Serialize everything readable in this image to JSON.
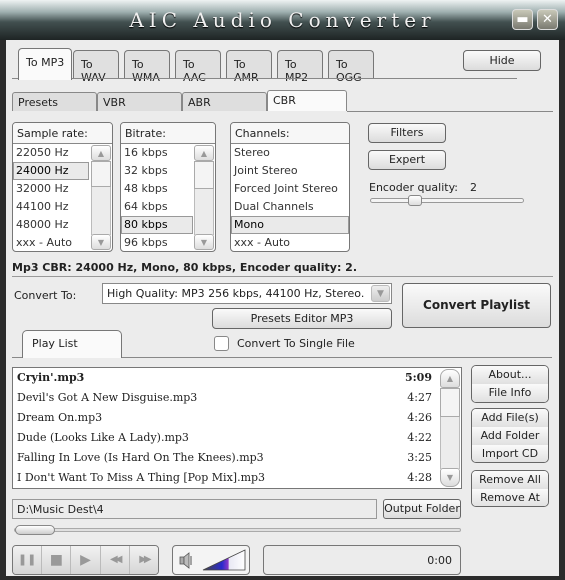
{
  "window": {
    "title": "AIC Audio Converter",
    "minimize_icon": "minimize-icon",
    "close_icon": "close-icon"
  },
  "format_tabs": [
    {
      "label": "To MP3",
      "active": true
    },
    {
      "label": "To WAV",
      "active": false
    },
    {
      "label": "To WMA",
      "active": false
    },
    {
      "label": "To AAC",
      "active": false
    },
    {
      "label": "To AMR",
      "active": false
    },
    {
      "label": "To MP2",
      "active": false
    },
    {
      "label": "To OGG",
      "active": false
    }
  ],
  "hide_label": "Hide",
  "mode_tabs": [
    {
      "label": "Presets",
      "active": false
    },
    {
      "label": "VBR",
      "active": false
    },
    {
      "label": "ABR",
      "active": false
    },
    {
      "label": "CBR",
      "active": true
    }
  ],
  "sample_rate": {
    "header": "Sample rate:",
    "items": [
      "22050 Hz",
      "24000 Hz",
      "32000 Hz",
      "44100 Hz",
      "48000 Hz",
      "xxx - Auto"
    ],
    "selected": "24000 Hz"
  },
  "bitrate": {
    "header": "Bitrate:",
    "items": [
      "16 kbps",
      "32 kbps",
      "48 kbps",
      "64 kbps",
      "80 kbps",
      "96 kbps"
    ],
    "selected": "80 kbps"
  },
  "channels": {
    "header": "Channels:",
    "items": [
      "Stereo",
      "Joint Stereo",
      "Forced Joint Stereo",
      "Dual Channels",
      "Mono",
      "xxx - Auto"
    ],
    "selected": "Mono"
  },
  "filters_label": "Filters",
  "expert_label": "Expert",
  "encoder_quality": {
    "label": "Encoder quality:",
    "value": "2",
    "min": 0,
    "max": 9
  },
  "summary": "Mp3 CBR: 24000 Hz, Mono, 80 kbps, Encoder quality: 2.",
  "convert_to": {
    "label": "Convert To:",
    "value": "High Quality: MP3 256 kbps, 44100 Hz, Stereo."
  },
  "presets_editor_label": "Presets Editor MP3",
  "convert_playlist_label": "Convert Playlist",
  "playlist_tab_label": "Play List",
  "single_file": {
    "label": "Convert To Single File",
    "checked": false
  },
  "playlist": [
    {
      "name": "Cryin'.mp3",
      "time": "5:09",
      "current": true
    },
    {
      "name": "Devil's Got A New Disguise.mp3",
      "time": "4:27",
      "current": false
    },
    {
      "name": "Dream On.mp3",
      "time": "4:26",
      "current": false
    },
    {
      "name": "Dude (Looks Like A Lady).mp3",
      "time": "4:22",
      "current": false
    },
    {
      "name": "Falling In Love (Is Hard On The Knees).mp3",
      "time": "3:25",
      "current": false
    },
    {
      "name": "I Don't Want To Miss A Thing [Pop Mix].mp3",
      "time": "4:28",
      "current": false
    }
  ],
  "side_buttons": {
    "about": "About...",
    "file_info": "File Info",
    "add_files": "Add File(s)",
    "add_folder": "Add Folder",
    "import_cd": "Import CD",
    "remove_all": "Remove All",
    "remove_at": "Remove At"
  },
  "output_folder": {
    "path": "D:\\Music Dest\\4",
    "button_label": "Output Folder"
  },
  "playback": {
    "position_fraction": 0.0,
    "time": "0:00",
    "volume_fraction": 0.6,
    "controls": [
      "pause-icon",
      "stop-icon",
      "play-icon",
      "rewind-icon",
      "fast-forward-icon"
    ],
    "pause_glyph": "❚❚",
    "stop_glyph": "■",
    "play_glyph": "▶",
    "rewind_glyph": "◀◀",
    "ff_glyph": "▶▶"
  }
}
